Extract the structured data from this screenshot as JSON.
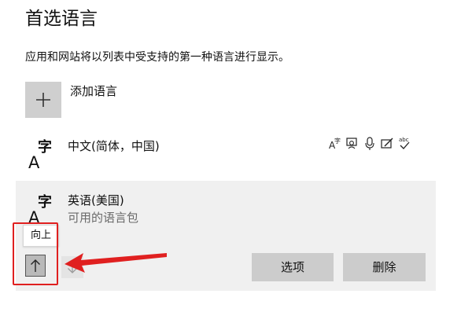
{
  "page": {
    "title": "首选语言",
    "description": "应用和网站将以列表中受支持的第一种语言进行显示。"
  },
  "add_language": {
    "label": "添加语言",
    "icon": "plus-icon"
  },
  "languages": [
    {
      "name": "中文(简体，中国)",
      "icon_letters": {
        "a": "A",
        "zi": "字"
      },
      "features": [
        "display-language-icon",
        "text-to-speech-icon",
        "speech-recognition-icon",
        "handwriting-icon",
        "spellcheck-icon"
      ]
    },
    {
      "name": "英语(美国)",
      "status": "可用的语言包",
      "icon_letters": {
        "a": "A",
        "zi": "字"
      }
    }
  ],
  "selected_language_actions": {
    "tooltip": "向上",
    "move_up_icon": "arrow-up-icon",
    "move_down_icon": "arrow-down-icon",
    "options_label": "选项",
    "remove_label": "删除"
  },
  "colors": {
    "panel_bg": "#f0f0f0",
    "button_bg": "#cccccc",
    "annotation_red": "#e02020"
  }
}
